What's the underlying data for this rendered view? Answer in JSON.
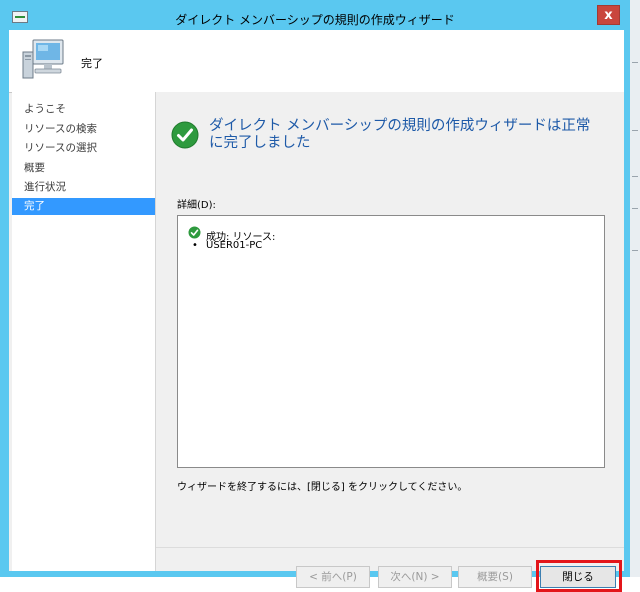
{
  "window": {
    "title": "ダイレクト メンバーシップの規則の作成ウィザード",
    "close_glyph": "x"
  },
  "header": {
    "title": "完了",
    "icon": "computer-icon"
  },
  "nav": {
    "items": [
      {
        "label": "ようこそ"
      },
      {
        "label": "リソースの検索"
      },
      {
        "label": "リソースの選択"
      },
      {
        "label": "概要"
      },
      {
        "label": "進行状況"
      },
      {
        "label": "完了"
      }
    ],
    "active_index": 5
  },
  "content": {
    "heading": "ダイレクト メンバーシップの規則の作成ウィザードは正常に完了しました",
    "details_label": "詳細(D):",
    "details": {
      "status": "成功: リソース:",
      "bullet": "•",
      "item": "USER01-PC"
    },
    "hint": "ウィザードを終了するには、[閉じる] をクリックしてください。"
  },
  "buttons": {
    "prev": "< 前へ(P)",
    "next": "次へ(N) >",
    "summary": "概要(S)",
    "close": "閉じる"
  },
  "colors": {
    "titlebar": "#5ac8f0",
    "accent_heading": "#1e5aa8",
    "nav_selected": "#3399ff",
    "highlight_border": "#e3151a",
    "success": "#2e9a3e"
  }
}
